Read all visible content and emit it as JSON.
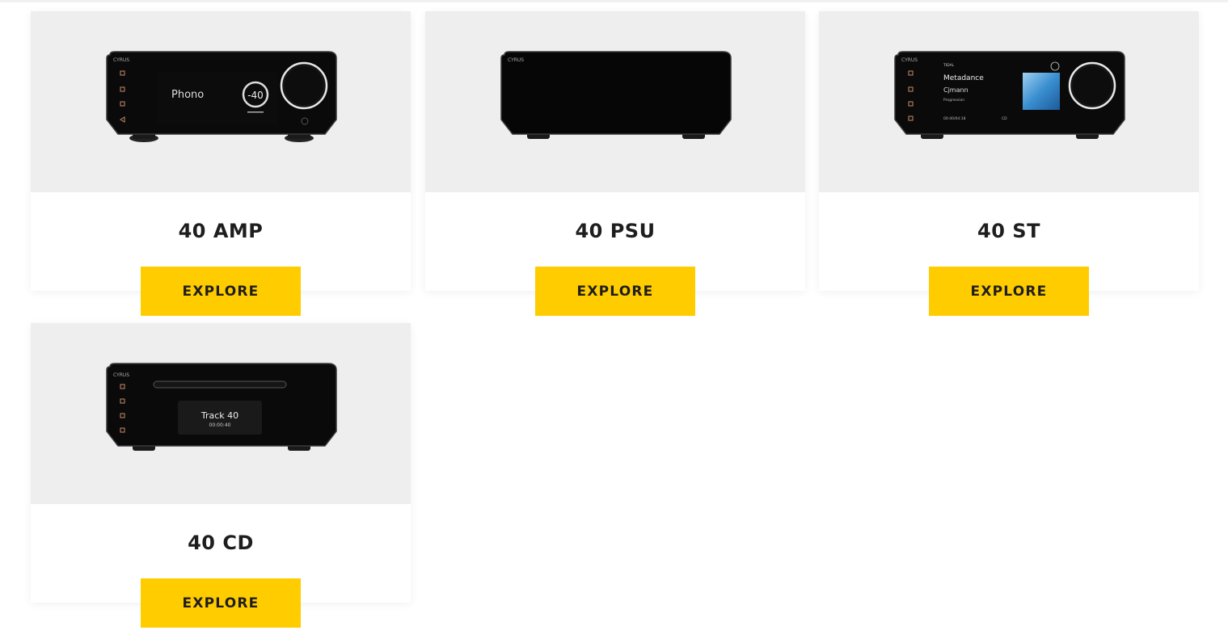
{
  "theme": {
    "accent": "#ffcc00",
    "card_media_bg": "#eeeeef",
    "text": "#1e1e1e"
  },
  "products": [
    {
      "name": "40 AMP",
      "button": "EXPLORE",
      "image_icon": "amplifier-image",
      "screen": {
        "source": "Phono",
        "volume": "-40",
        "logo": "CYRUS"
      }
    },
    {
      "name": "40 PSU",
      "button": "EXPLORE",
      "image_icon": "power-supply-image",
      "screen": {
        "logo": "CYRUS"
      }
    },
    {
      "name": "40 ST",
      "button": "EXPLORE",
      "image_icon": "streamer-image",
      "screen": {
        "logo": "CYRUS",
        "service": "TIDAL",
        "track": "Metadance",
        "artist": "Cjmann",
        "album": "Progression",
        "time": "00:40/04:18",
        "format": "CD"
      }
    },
    {
      "name": "40 CD",
      "button": "EXPLORE",
      "image_icon": "cd-player-image",
      "screen": {
        "logo": "CYRUS",
        "track": "Track 40",
        "time": "00:00:40"
      }
    }
  ]
}
